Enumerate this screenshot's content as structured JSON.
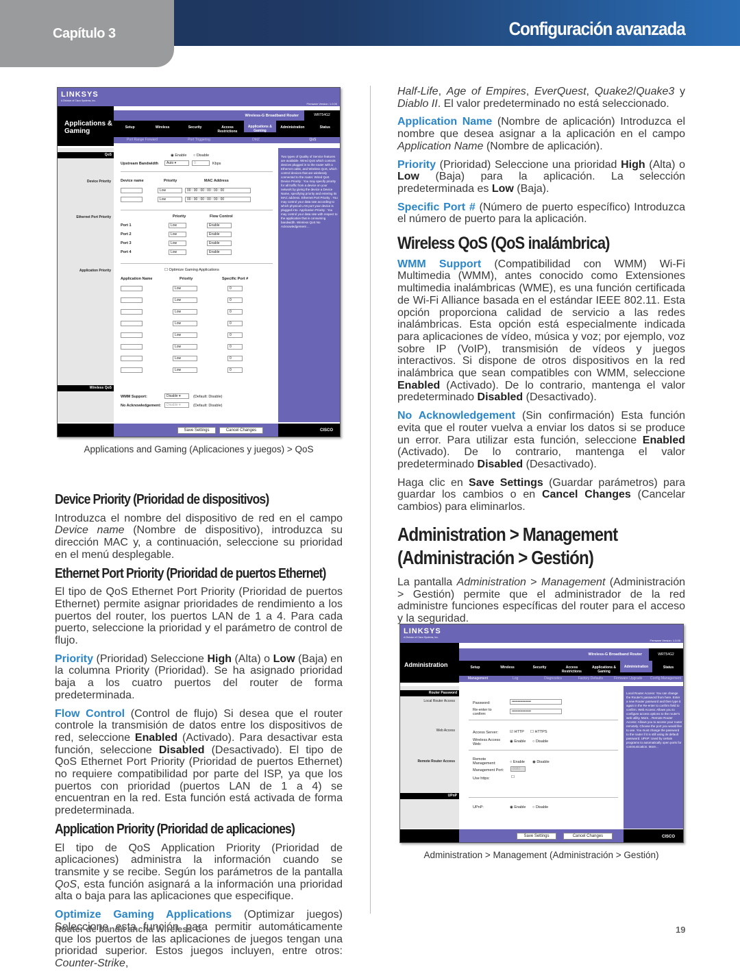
{
  "header": {
    "chapter": "Capítulo 3",
    "title": "Configuración avanzada"
  },
  "colors": {
    "header_dark": "#1d3358",
    "header_light": "#2a6db5",
    "chapter_tab": "#9a9b9d",
    "link_blue": "#2b86c8",
    "router_purple": "#6b65b5"
  },
  "left": [
    {
      "type": "h",
      "segs": [
        [
          "Device Priority (Prioridad de dispositivos)",
          ""
        ]
      ]
    },
    {
      "type": "p",
      "segs": [
        [
          "Introduzca el nombre del dispositivo de red en el campo ",
          ""
        ],
        [
          "Device name",
          "i"
        ],
        [
          " (Nombre de dispositivo), introduzca su dirección MAC y, a continuación, seleccione su prioridad en el menú desplegable.",
          ""
        ]
      ]
    },
    {
      "type": "h",
      "segs": [
        [
          "Ethernet Port Priority (Prioridad de puertos Ethernet)",
          ""
        ]
      ]
    },
    {
      "type": "p",
      "segs": [
        [
          "El tipo de QoS Ethernet Port Priority (Prioridad de puertos Ethernet) permite asignar prioridades de rendimiento a los puertos del router, los puertos LAN de 1 a 4. Para cada puerto, seleccione la prioridad y el parámetro de control de flujo.",
          ""
        ]
      ]
    },
    {
      "type": "p",
      "segs": [
        [
          "Priority",
          "blue"
        ],
        [
          "  (Prioridad) Seleccione ",
          ""
        ],
        [
          "High",
          "b"
        ],
        [
          " (Alta) o ",
          ""
        ],
        [
          "Low",
          "b"
        ],
        [
          " (Baja) en la columna Priority (Prioridad). Se ha asignado prioridad baja a los cuatro puertos del router de forma predeterminada.",
          ""
        ]
      ]
    },
    {
      "type": "p",
      "segs": [
        [
          "Flow Control",
          "blue"
        ],
        [
          " (Control de flujo) Si desea que el router controle la transmisión de datos entre los dispositivos de red, seleccione ",
          ""
        ],
        [
          "Enabled",
          "b"
        ],
        [
          " (Activado). Para desactivar esta función, seleccione ",
          ""
        ],
        [
          "Disabled",
          "b"
        ],
        [
          " (Desactivado). El tipo de QoS Ethernet Port Priority (Prioridad de puertos Ethernet) no requiere compatibilidad por parte del ISP, ya que los puertos con prioridad (puertos LAN de 1 a 4) se encuentran en la red. Esta función está activada de forma predeterminada.",
          ""
        ]
      ]
    },
    {
      "type": "h",
      "segs": [
        [
          "Application Priority (Prioridad de aplicaciones)",
          ""
        ]
      ]
    },
    {
      "type": "p",
      "segs": [
        [
          "El tipo de QoS Application Priority (Prioridad de aplicaciones) administra la información cuando se transmite y se recibe. Según los parámetros de la pantalla ",
          ""
        ],
        [
          "QoS",
          "i"
        ],
        [
          ", esta función asignará a la información una prioridad alta o baja para las aplicaciones que especifique.",
          ""
        ]
      ]
    },
    {
      "type": "p",
      "segs": [
        [
          "Optimize Gaming Applications",
          "blue"
        ],
        [
          " (Optimizar juegos) Seleccione esta función para permitir automáticamente que los puertos de las aplicaciones de juegos tengan una prioridad superior. Estos juegos incluyen, entre otros: ",
          ""
        ],
        [
          "Counter-Strike",
          "i"
        ],
        [
          ",",
          ""
        ]
      ]
    }
  ],
  "right": [
    {
      "type": "p",
      "segs": [
        [
          "Half-Life",
          "i"
        ],
        [
          ", ",
          ""
        ],
        [
          "Age of Empires",
          "i"
        ],
        [
          ", ",
          ""
        ],
        [
          "EverQuest",
          "i"
        ],
        [
          ", ",
          ""
        ],
        [
          "Quake2",
          "i"
        ],
        [
          "/",
          ""
        ],
        [
          "Quake3",
          "i"
        ],
        [
          " y ",
          ""
        ],
        [
          "Diablo II",
          "i"
        ],
        [
          ". El valor predeterminado no está seleccionado.",
          ""
        ]
      ]
    },
    {
      "type": "p",
      "segs": [
        [
          "Application Name",
          "blue"
        ],
        [
          " (Nombre de aplicación) Introduzca el nombre que desea asignar a la aplicación en el campo ",
          ""
        ],
        [
          "Application Name",
          "i"
        ],
        [
          " (Nombre de aplicación).",
          ""
        ]
      ]
    },
    {
      "type": "p",
      "segs": [
        [
          "Priority",
          "blue"
        ],
        [
          "  (Prioridad) Seleccione una prioridad ",
          ""
        ],
        [
          "High",
          "b"
        ],
        [
          " (Alta) o ",
          ""
        ],
        [
          "Low",
          "b"
        ],
        [
          " (Baja) para la aplicación. La selección predeterminada es ",
          ""
        ],
        [
          "Low",
          "b"
        ],
        [
          " (Baja).",
          ""
        ]
      ]
    },
    {
      "type": "p",
      "segs": [
        [
          "Specific Port #",
          "blue"
        ],
        [
          "  (Número de puerto específico) Introduzca el número de puerto para la aplicación.",
          ""
        ]
      ]
    },
    {
      "type": "hmid",
      "segs": [
        [
          "Wireless QoS (QoS inalámbrica)",
          ""
        ]
      ]
    },
    {
      "type": "p",
      "segs": [
        [
          "WMM Support",
          "blue"
        ],
        [
          "  (Compatibilidad con WMM) Wi-Fi Multimedia (WMM), antes conocido como Extensiones multimedia inalámbricas (WME), es una función certificada de Wi-Fi Alliance basada en el estándar IEEE 802.11. Esta opción proporciona calidad de servicio a las redes inalámbricas. Esta opción está especialmente indicada para aplicaciones de vídeo, música y voz; por ejemplo, voz sobre IP (VoIP), transmisión de vídeos y juegos interactivos. Si dispone de otros dispositivos en la red inalámbrica que sean compatibles con WMM, seleccione ",
          ""
        ],
        [
          "Enabled",
          "b"
        ],
        [
          " (Activado). De lo contrario, mantenga el valor predeterminado ",
          ""
        ],
        [
          "Disabled",
          "b"
        ],
        [
          " (Desactivado).",
          ""
        ]
      ]
    },
    {
      "type": "p",
      "segs": [
        [
          "No Acknowledgement",
          "blue"
        ],
        [
          "  (Sin confirmación) Esta función evita que el router vuelva a enviar los datos si se produce un error. Para utilizar esta función, seleccione ",
          ""
        ],
        [
          "Enabled",
          "b"
        ],
        [
          " (Activado). De lo contrario, mantenga el valor predeterminado ",
          ""
        ],
        [
          "Disabled",
          "b"
        ],
        [
          " (Desactivado).",
          ""
        ]
      ]
    },
    {
      "type": "p",
      "segs": [
        [
          "Haga clic en ",
          ""
        ],
        [
          "Save Settings",
          "b"
        ],
        [
          " (Guardar parámetros) para guardar los cambios o en ",
          ""
        ],
        [
          "Cancel Changes",
          "b"
        ],
        [
          " (Cancelar cambios) para eliminarlos.",
          ""
        ]
      ]
    },
    {
      "type": "hbig",
      "segs": [
        [
          "Administration > Management (Administración > Gestión)",
          ""
        ]
      ]
    },
    {
      "type": "p",
      "segs": [
        [
          "La pantalla ",
          ""
        ],
        [
          "Administration",
          "i"
        ],
        [
          " > ",
          ""
        ],
        [
          "Management",
          "i"
        ],
        [
          " (Administración > Gestión) permite que el administrador de la red administre funciones específicas del router para el acceso y la seguridad.",
          ""
        ]
      ]
    }
  ],
  "captions": {
    "qos": "Applications and Gaming (Aplicaciones y juegos) > QoS",
    "admin": "Administration > Management (Administración > Gestión)"
  },
  "footer": {
    "left": "Router de banda ancha Wireless-G",
    "page": "19"
  },
  "shot1": {
    "logo": "LINKSYS",
    "sublogo": "A Division of Cisco Systems, Inc.",
    "firmware": "Firmware Version: 1.0.00",
    "section": "Applications & Gaming",
    "product": "Wireless-G Broadband Router",
    "model": "WRT54G2",
    "tabs": [
      "Setup",
      "Wireless",
      "Security",
      "Access Restrictions",
      "Applications & Gaming",
      "Administration",
      "Status"
    ],
    "subtabs": [
      "Port Range Forward",
      "Port Triggering",
      "DMZ",
      "QoS"
    ],
    "labels": {
      "qos": "QoS",
      "device": "Device Priority",
      "ethernet": "Ethernet Port Priority",
      "app": "Application Priority",
      "wireless": "Wireless QoS"
    },
    "enable": "Enable",
    "disable": "Disable",
    "upstream": "Upstream Bandwidth",
    "upstream_val": "Auto",
    "kbps": "Kbps",
    "upstream_num": "0",
    "dev_cols": [
      "Device name",
      "Priority",
      "MAC Address"
    ],
    "mac": "00 : 00 : 00 : 00 : 00 : 00",
    "port_cols": [
      "Priority",
      "Flow Control"
    ],
    "ports": [
      "Port 1",
      "Port 2",
      "Port 3",
      "Port 4"
    ],
    "low": "Low",
    "enable_sel": "Enable",
    "optimize": "Optimize Gaming Applications",
    "app_cols": [
      "Application Name",
      "Priority",
      "Specific Port #"
    ],
    "port_zero": "0",
    "wmm": "WMM Support:",
    "wmm_val": "Disable",
    "noack": "No Acknowledgement:",
    "noack_val": "Disable",
    "default": "(Default: Disable)",
    "help": "Two types of Quality of Service features are available. Wired QoS which controls devices plugged in to the router with a Ethernet cable, and Wireless QoS, which control devices that are wirelessly connected to the router. Wired QoS  Device Priority : You may specify priority for all traffic from a device on your network by giving the device a Device Name, specifying priority and entering its MAC address.  Ethernet Port Priority : You may control your data rate according to which physical LAN port your device is plugged into.  Application Priority : You may control your data rate with respect to the application that is consuming bandwidth.  Wireless QoS  No Acknowledgement ...",
    "save": "Save Settings",
    "cancel": "Cancel Changes",
    "cisco": "CISCO"
  },
  "shot2": {
    "logo": "LINKSYS",
    "sublogo": "A Division of Cisco Systems, Inc.",
    "firmware": "Firmware Version: 1.0.00",
    "section": "Administration",
    "product": "Wireless-G Broadband Router",
    "model": "WRT54G2",
    "tabs": [
      "Setup",
      "Wireless",
      "Security",
      "Access Restrictions",
      "Applications & Gaming",
      "Administration",
      "Status"
    ],
    "subtabs": [
      "Management",
      "Log",
      "Diagnostics",
      "Factory Defaults",
      "Firmware Upgrade",
      "Config Management"
    ],
    "labels": {
      "pwd": "Router Password",
      "local": "Local Router Access",
      "web": "Web Access",
      "remote": "Remote Router Access",
      "upnp": "UPnP"
    },
    "password": "Password:",
    "reenter": "Re-enter to confirm:",
    "pwd_val": "••••••••••••••••",
    "access_server": "Access Server:",
    "http": "HTTP",
    "https": "HTTPS",
    "wireless_web": "Wireless Access Web:",
    "remote_mgmt": "Remote Management:",
    "mgmt_port": "Management Port:",
    "mgmt_port_val": "8080",
    "use_https": "Use https:",
    "upnp_lbl": "UPnP:",
    "enable": "Enable",
    "disable": "Disable",
    "help": "Local Router Access: You can change the Router's password from here. Enter a new Router password and then type it again in the Re-enter to confirm field to confirm.  Web Access: Allows you to configure access options to the router's web utility. More...  Remote Router Access: Allows you to access your router remotely. Choose the port you would like to use. You must change the password to the router if it is still using its default password.  UPnP: Used by certain programs to automatically open ports for communication. More...",
    "save": "Save Settings",
    "cancel": "Cancel Changes",
    "cisco": "CISCO"
  }
}
